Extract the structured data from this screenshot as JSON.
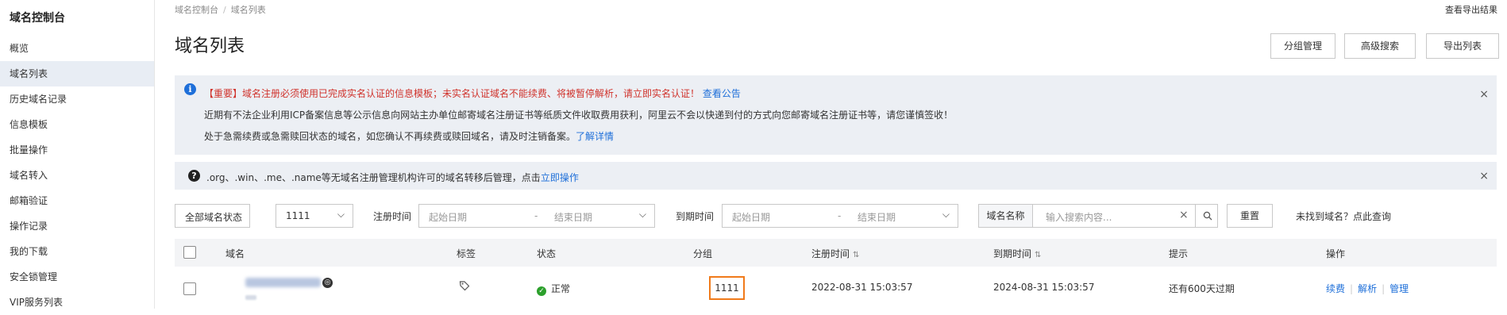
{
  "sidebar": {
    "title": "域名控制台",
    "items": [
      {
        "label": "概览"
      },
      {
        "label": "域名列表"
      },
      {
        "label": "历史域名记录"
      },
      {
        "label": "信息模板"
      },
      {
        "label": "批量操作"
      },
      {
        "label": "域名转入"
      },
      {
        "label": "邮箱验证"
      },
      {
        "label": "操作记录"
      },
      {
        "label": "我的下载"
      },
      {
        "label": "安全锁管理"
      },
      {
        "label": "VIP服务列表"
      }
    ]
  },
  "breadcrumb": {
    "home": "域名控制台",
    "current": "域名列表",
    "sep": "/"
  },
  "header": {
    "title": "域名列表",
    "export_result": "查看导出结果",
    "buttons": {
      "group": "分组管理",
      "advanced": "高级搜索",
      "export": "导出列表"
    }
  },
  "notice1": {
    "icon": "i",
    "line1_red": "【重要】域名注册必须使用已完成实名认证的信息模板；未实名认证域名不能续费、将被暂停解析，请立即实名认证！",
    "line1_link": "查看公告",
    "line2": "近期有不法企业利用ICP备案信息等公示信息向网站主办单位邮寄域名注册证书等纸质文件收取费用获利，阿里云不会以快递到付的方式向您邮寄域名注册证书等，请您谨慎签收！",
    "line3": "处于急需续费或急需赎回状态的域名，如您确认不再续费或赎回域名，请及时注销备案。",
    "line3_link": "了解详情",
    "close": "×"
  },
  "notice2": {
    "icon": "?",
    "text": ".org、.win、.me、.name等无域名注册管理机构许可的域名转移后管理，点击",
    "link": "立即操作",
    "close": "×"
  },
  "filters": {
    "status_select": "全部域名状态",
    "group_select": "1111",
    "reg_label": "注册时间",
    "reg_start": "起始日期",
    "reg_end": "结束日期",
    "range_sep": "-",
    "exp_label": "到期时间",
    "exp_start": "起始日期",
    "exp_end": "结束日期",
    "search_type": "域名名称",
    "search_placeholder": "输入搜索内容...",
    "clear": "×",
    "reset": "重置",
    "not_found_link": "未找到域名？点此查询"
  },
  "table": {
    "headers": {
      "domain": "域名",
      "tag": "标签",
      "status": "状态",
      "group": "分组",
      "reg_time": "注册时间",
      "exp_time": "到期时间",
      "tip": "提示",
      "action": "操作"
    },
    "sort_glyph": "⇅",
    "rows": [
      {
        "status": "正常",
        "group": "1111",
        "reg_time": "2022-08-31 15:03:57",
        "exp_time": "2024-08-31 15:03:57",
        "tip": "还有600天过期",
        "actions": {
          "renew": "续费",
          "resolve": "解析",
          "manage": "管理"
        }
      }
    ]
  }
}
